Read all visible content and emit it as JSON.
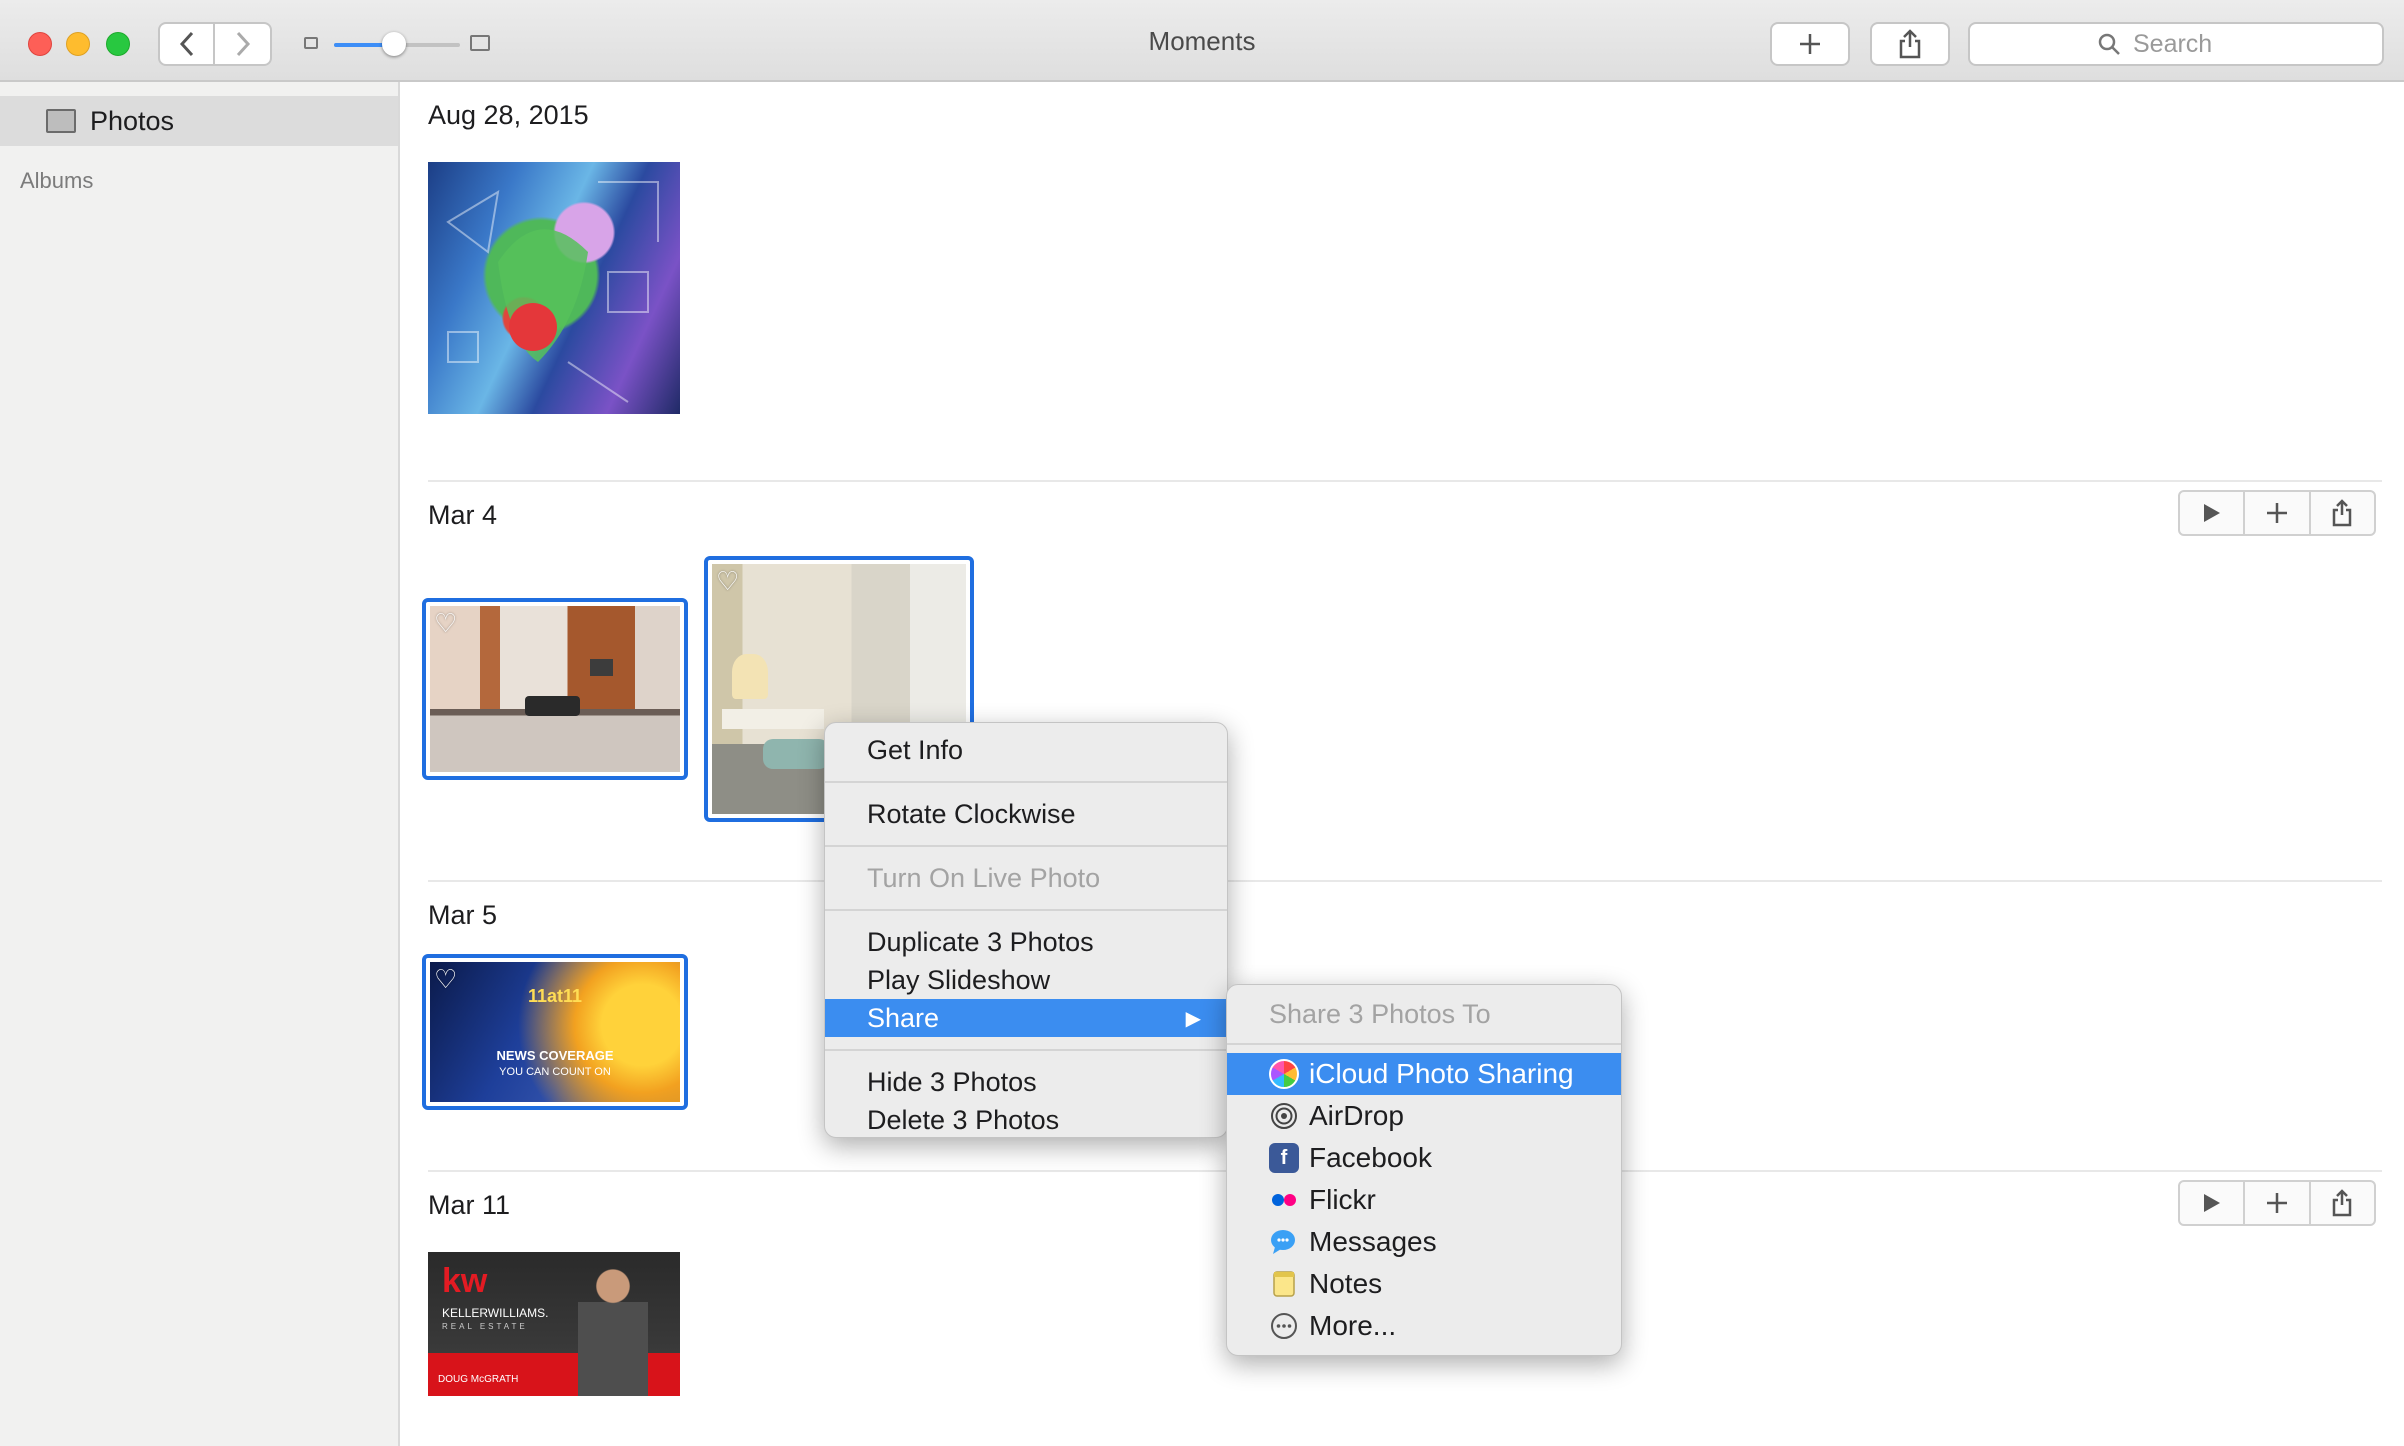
{
  "window": {
    "title": "Moments",
    "search_placeholder": "Search"
  },
  "sidebar": {
    "photos_label": "Photos",
    "albums_label": "Albums"
  },
  "moments": [
    {
      "date": "Aug 28, 2015"
    },
    {
      "date": "Mar 4"
    },
    {
      "date": "Mar 5"
    },
    {
      "date": "Mar 11"
    }
  ],
  "thumb_text": {
    "news_title": "11at11",
    "news_line1": "NEWS COVERAGE",
    "news_line2": "YOU CAN COUNT ON",
    "kw_logo": "kw",
    "kw_company": "KELLERWILLIAMS.",
    "kw_sub": "REAL ESTATE",
    "kw_agent": "DOUG McGRATH"
  },
  "context_menu": {
    "get_info": "Get Info",
    "rotate": "Rotate Clockwise",
    "live_photo": "Turn On Live Photo",
    "duplicate": "Duplicate 3 Photos",
    "slideshow": "Play Slideshow",
    "share": "Share",
    "hide": "Hide 3 Photos",
    "delete": "Delete 3 Photos"
  },
  "share_menu": {
    "header": "Share 3 Photos To",
    "icloud": "iCloud Photo Sharing",
    "airdrop": "AirDrop",
    "facebook": "Facebook",
    "flickr": "Flickr",
    "messages": "Messages",
    "notes": "Notes",
    "more": "More..."
  },
  "colors": {
    "accent": "#3b8df0",
    "selection_border": "#1f6ee0"
  }
}
